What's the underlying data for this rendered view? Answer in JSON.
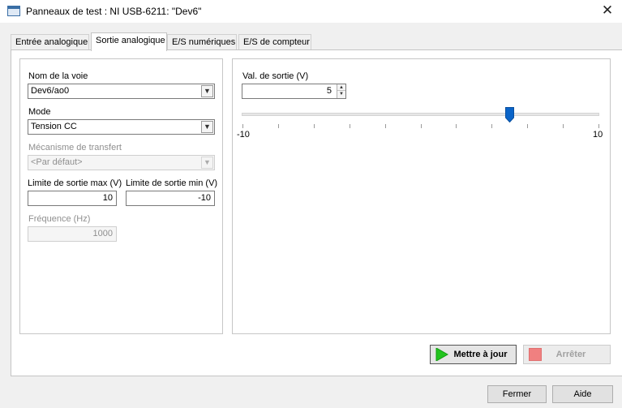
{
  "window": {
    "title": "Panneaux de test : NI USB-6211: \"Dev6\"",
    "close_icon": "close-icon"
  },
  "tabs": [
    {
      "label": "Entrée analogique",
      "active": false
    },
    {
      "label": "Sortie analogique",
      "active": true
    },
    {
      "label": "E/S numériques",
      "active": false
    },
    {
      "label": "E/S de compteur",
      "active": false
    }
  ],
  "config": {
    "channel_name_label": "Nom de la voie",
    "channel_name_value": "Dev6/ao0",
    "mode_label": "Mode",
    "mode_value": "Tension CC",
    "transfer_label": "Mécanisme de transfert",
    "transfer_value": "<Par défaut>",
    "max_limit_label": "Limite de sortie max (V)",
    "max_limit_value": "10",
    "min_limit_label": "Limite de sortie min (V)",
    "min_limit_value": "-10",
    "frequency_label": "Fréquence (Hz)",
    "frequency_value": "1000"
  },
  "output": {
    "value_label": "Val. de sortie (V)",
    "value": "5",
    "slider_min_label": "-10",
    "slider_max_label": "10",
    "slider_min": -10,
    "slider_max": 10,
    "slider_value": 5,
    "accent_color": "#0a64c8"
  },
  "actions": {
    "update_label": "Mettre à jour",
    "stop_label": "Arrêter",
    "play_icon": "play-icon",
    "stop_icon": "stop-icon"
  },
  "footer": {
    "close_label": "Fermer",
    "help_label": "Aide"
  }
}
